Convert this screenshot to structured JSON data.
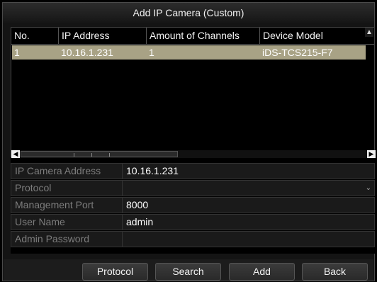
{
  "dialog": {
    "title": "Add IP Camera (Custom)"
  },
  "camera_list": {
    "columns": [
      "No.",
      "IP Address",
      "Amount of Channels",
      "Device Model"
    ],
    "rows": [
      {
        "no": "1",
        "ip": "10.16.1.231",
        "channels": "1",
        "model": "iDS-TCS215-F7",
        "selected": true
      }
    ],
    "selected_row_color": "#a8a285"
  },
  "form": {
    "ip_camera_address": {
      "label": "IP Camera Address",
      "value": "10.16.1.231"
    },
    "protocol": {
      "label": "Protocol",
      "value": ""
    },
    "management_port": {
      "label": "Management Port",
      "value": "8000"
    },
    "user_name": {
      "label": "User Name",
      "value": "admin"
    },
    "admin_password": {
      "label": "Admin Password",
      "value": ""
    }
  },
  "buttons": {
    "protocol": "Protocol",
    "search": "Search",
    "add": "Add",
    "back": "Back"
  },
  "icons": {
    "scroll_left": "chevron-left-icon",
    "scroll_right": "chevron-right-icon",
    "scroll_up": "chevron-up-icon",
    "dropdown": "chevron-down-icon"
  }
}
